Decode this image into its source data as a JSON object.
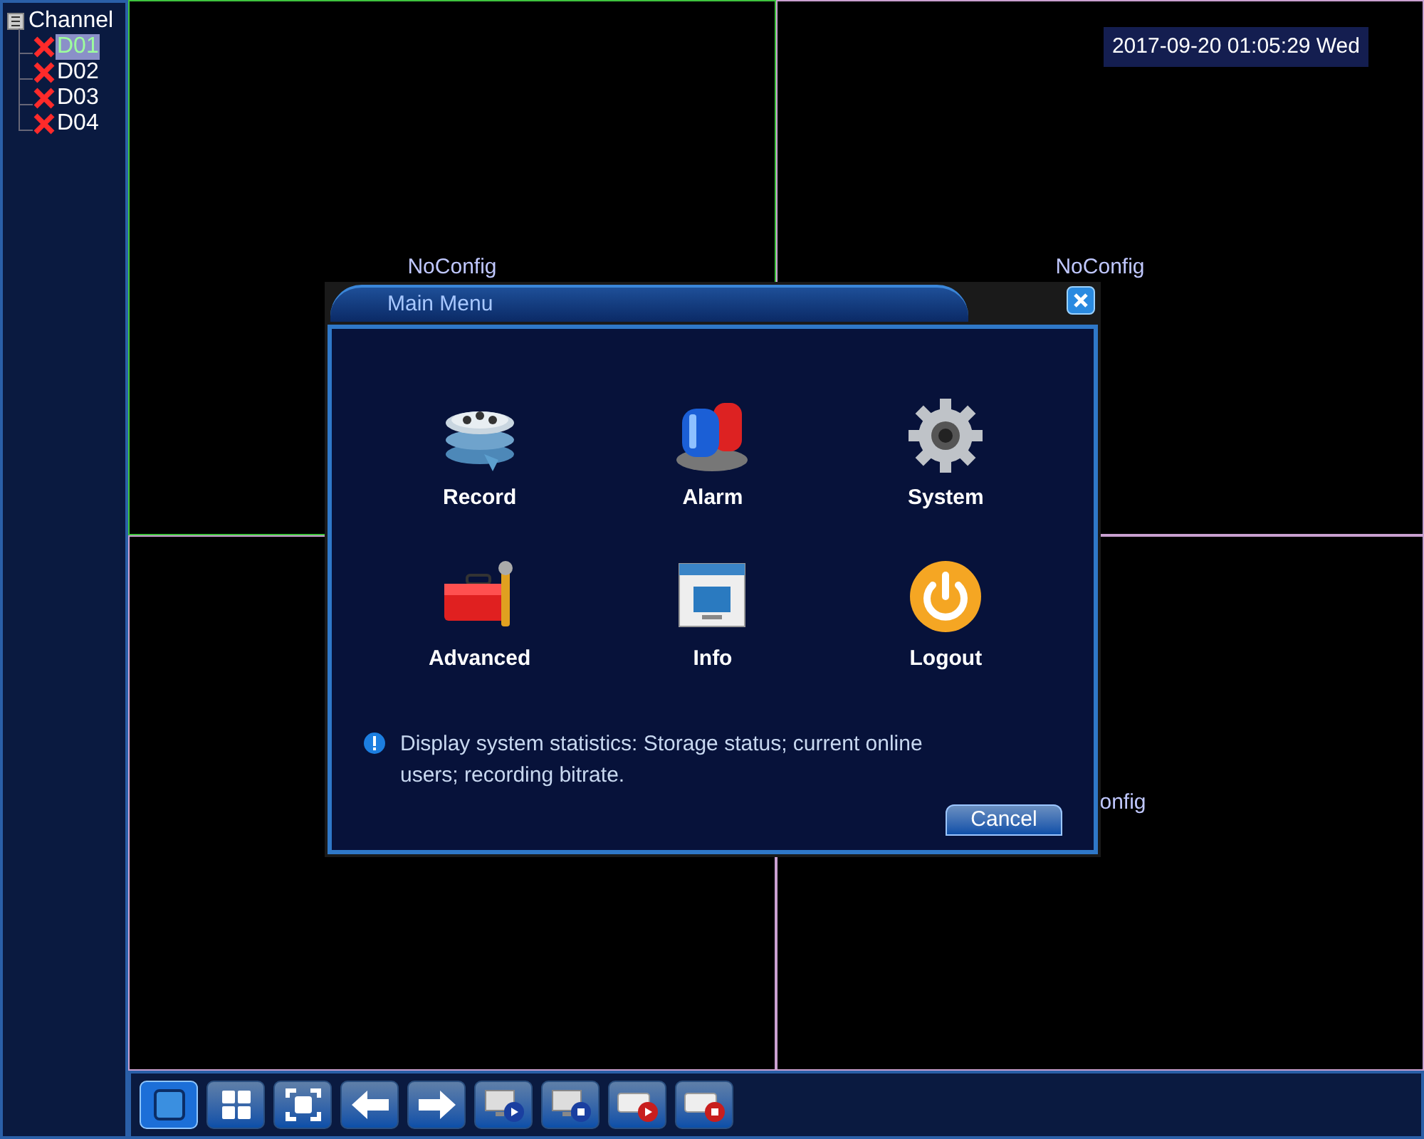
{
  "channel_tree": {
    "label": "Channel",
    "children": [
      {
        "label": "D01",
        "selected": true
      },
      {
        "label": "D02",
        "selected": false
      },
      {
        "label": "D03",
        "selected": false
      },
      {
        "label": "D04",
        "selected": false
      }
    ]
  },
  "timestamp": "2017-09-20 01:05:29 Wed",
  "views": [
    {
      "kind": "labeled",
      "label": "NoConfig"
    },
    {
      "kind": "labeled",
      "label": "NoConfig"
    },
    {
      "kind": "blank"
    },
    {
      "kind": "labeled",
      "label": "onfig"
    }
  ],
  "dialog": {
    "title": "Main Menu",
    "items": [
      {
        "kind": "record",
        "label": "Record"
      },
      {
        "kind": "alarm",
        "label": "Alarm"
      },
      {
        "kind": "system",
        "label": "System"
      },
      {
        "kind": "advanced",
        "label": "Advanced"
      },
      {
        "kind": "info",
        "label": "Info"
      },
      {
        "kind": "logout",
        "label": "Logout"
      }
    ],
    "hint": "Display system statistics: Storage status; current online users; recording bitrate.",
    "cancel": "Cancel"
  },
  "toolbar": [
    {
      "kind": "single",
      "selected": true
    },
    {
      "kind": "quad",
      "selected": false
    },
    {
      "kind": "fullscreen",
      "selected": false
    },
    {
      "kind": "prev",
      "selected": false
    },
    {
      "kind": "next",
      "selected": false
    },
    {
      "kind": "play-monitor",
      "selected": false
    },
    {
      "kind": "stop-monitor",
      "selected": false
    },
    {
      "kind": "play-record",
      "selected": false
    },
    {
      "kind": "stop-record",
      "selected": false
    }
  ]
}
